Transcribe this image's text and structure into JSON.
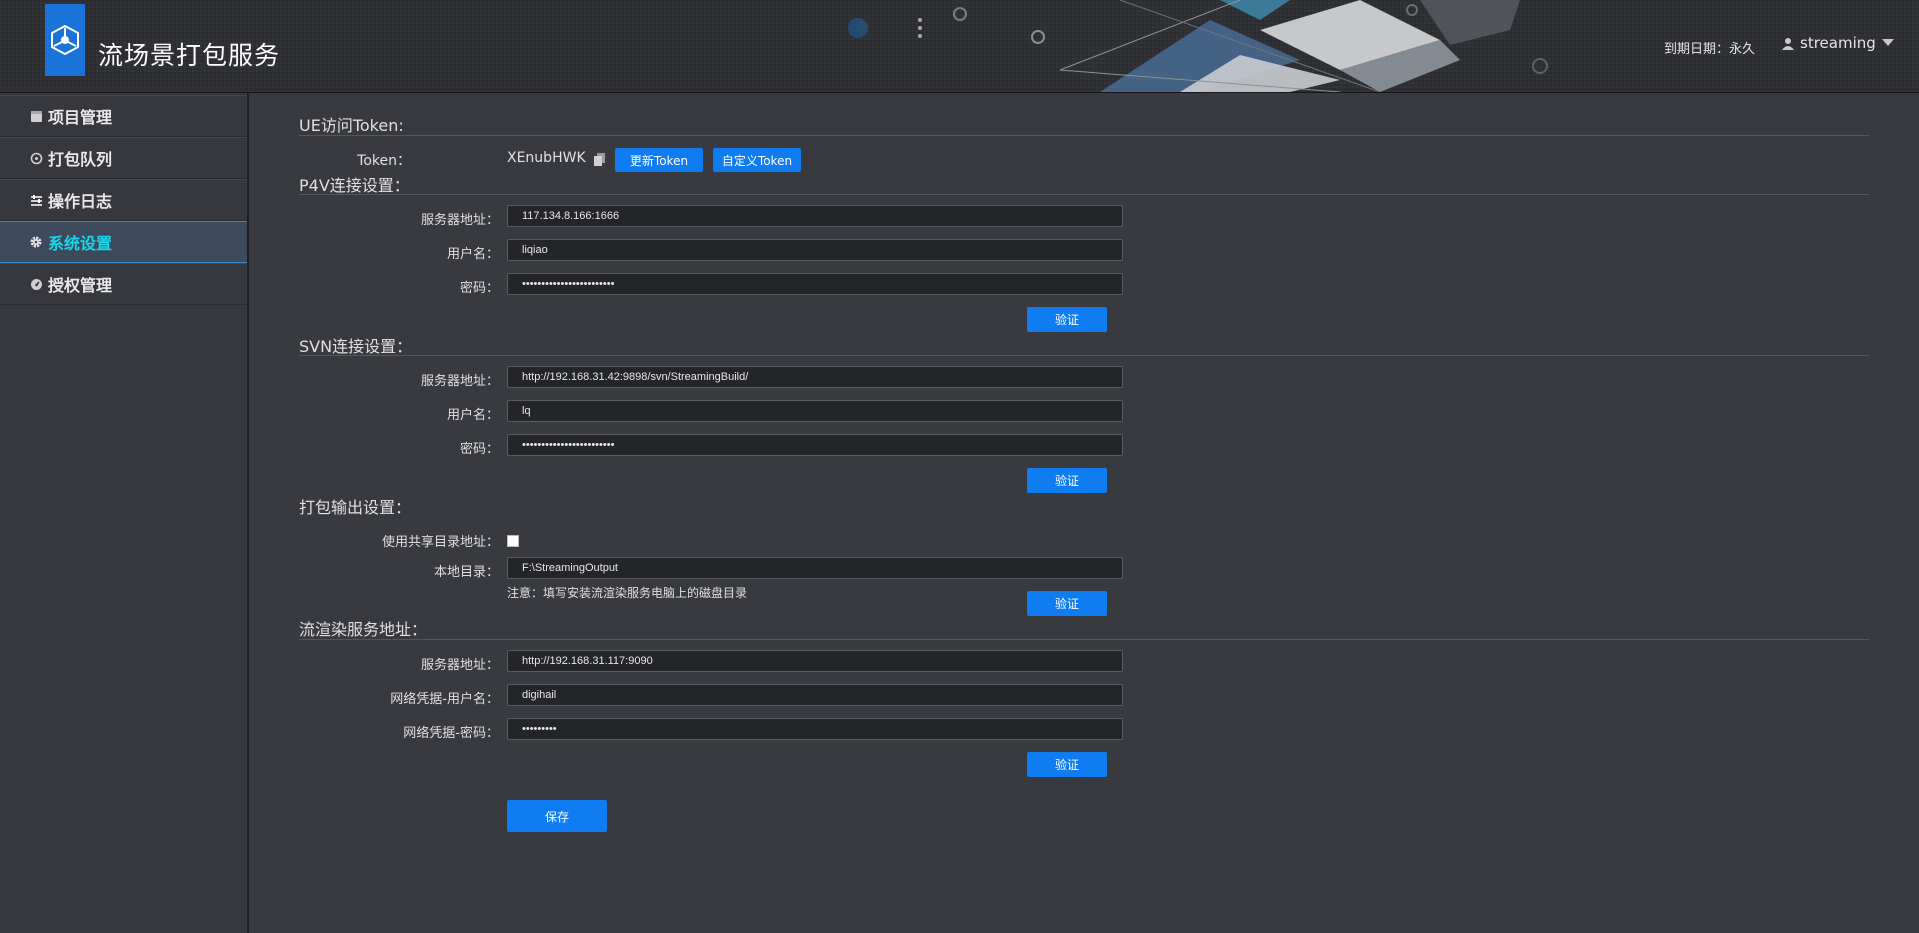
{
  "header": {
    "app_title": "流场景打包服务",
    "expire_label": "到期日期：",
    "expire_value": "永久",
    "username": "streaming"
  },
  "sidebar": {
    "items": [
      {
        "label": "项目管理",
        "icon": "box-icon"
      },
      {
        "label": "打包队列",
        "icon": "refresh-icon"
      },
      {
        "label": "操作日志",
        "icon": "sliders-icon"
      },
      {
        "label": "系统设置",
        "icon": "gear-icon",
        "active": true
      },
      {
        "label": "授权管理",
        "icon": "dashboard-icon"
      }
    ]
  },
  "token": {
    "section_title": "UE访问Token:",
    "label": "Token：",
    "value": "XEnubHWK",
    "update_label": "更新Token",
    "custom_label": "自定义Token"
  },
  "p4v": {
    "section_title": "P4V连接设置：",
    "server_label": "服务器地址：",
    "server_value": "117.134.8.166:1666",
    "user_label": "用户名：",
    "user_value": "liqiao",
    "password_label": "密码：",
    "password_value": "••••••••••••••••••••••••",
    "verify_label": "验证"
  },
  "svn": {
    "section_title": "SVN连接设置：",
    "server_label": "服务器地址：",
    "server_value": "http://192.168.31.42:9898/svn/StreamingBuild/",
    "user_label": "用户名：",
    "user_value": "lq",
    "password_label": "密码：",
    "password_value": "••••••••••••••••••••••••",
    "verify_label": "验证"
  },
  "output": {
    "section_title": "打包输出设置：",
    "shared_label": "使用共享目录地址：",
    "shared_checked": false,
    "local_label": "本地目录：",
    "local_value": "F:\\StreamingOutput",
    "note": "注意：填写安装流渲染服务电脑上的磁盘目录",
    "verify_label": "验证"
  },
  "render": {
    "section_title": "流渲染服务地址：",
    "server_label": "服务器地址：",
    "server_value": "http://192.168.31.117:9090",
    "user_label": "网络凭据-用户名：",
    "user_value": "digihail",
    "password_label": "网络凭据-密码：",
    "password_value": "•••••••••",
    "verify_label": "验证"
  },
  "save_label": "保存",
  "colors": {
    "accent": "#0f7cf2",
    "active_nav_text": "#19d6ea",
    "background": "#393a3f"
  }
}
